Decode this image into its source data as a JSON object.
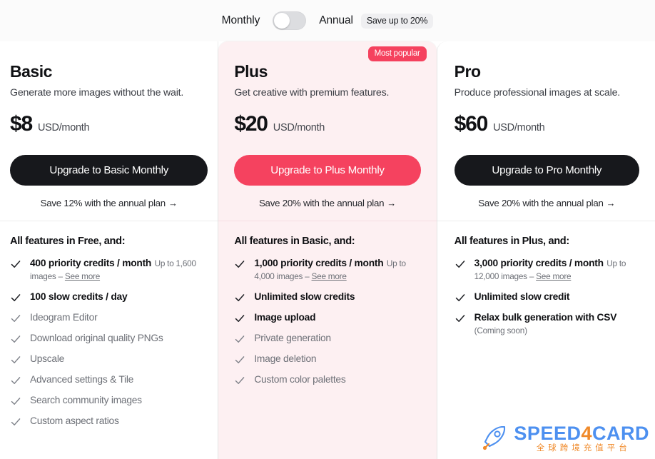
{
  "billing_toggle": {
    "monthly_label": "Monthly",
    "annual_label": "Annual",
    "save_badge": "Save up to 20%",
    "selected": "Monthly"
  },
  "colors": {
    "accent_red": "#f5425f",
    "plus_card_bg": "#fdf0f2",
    "dark_button": "#17181c",
    "muted_text": "#6d7077",
    "watermark_blue": "#4d90f0",
    "watermark_orange": "#f08a2a"
  },
  "plans": [
    {
      "id": "basic",
      "name": "Basic",
      "description": "Generate more images without the wait.",
      "price": "$8",
      "price_unit": "USD/month",
      "cta_label": "Upgrade to Basic Monthly",
      "annual_link": "Save 12% with the annual plan",
      "badge": null,
      "features_title": "All features in Free, and:",
      "features": [
        {
          "label": "400 priority credits / month",
          "sub": "Up to 1,600 images – ",
          "sub_link": "See more",
          "emphasis": true
        },
        {
          "label": "100 slow credits / day",
          "sub": null,
          "sub_link": null,
          "emphasis": true
        },
        {
          "label": "Ideogram Editor",
          "sub": null,
          "sub_link": null,
          "emphasis": false
        },
        {
          "label": "Download original quality PNGs",
          "sub": null,
          "sub_link": null,
          "emphasis": false
        },
        {
          "label": "Upscale",
          "sub": null,
          "sub_link": null,
          "emphasis": false
        },
        {
          "label": "Advanced settings & Tile",
          "sub": null,
          "sub_link": null,
          "emphasis": false
        },
        {
          "label": "Search community images",
          "sub": null,
          "sub_link": null,
          "emphasis": false
        },
        {
          "label": "Custom aspect ratios",
          "sub": null,
          "sub_link": null,
          "emphasis": false
        }
      ]
    },
    {
      "id": "plus",
      "name": "Plus",
      "description": "Get creative with premium features.",
      "price": "$20",
      "price_unit": "USD/month",
      "cta_label": "Upgrade to Plus Monthly",
      "annual_link": "Save 20% with the annual plan",
      "badge": "Most popular",
      "features_title": "All features in Basic, and:",
      "features": [
        {
          "label": "1,000 priority credits / month",
          "sub": "Up to 4,000 images – ",
          "sub_link": "See more",
          "emphasis": true
        },
        {
          "label": "Unlimited slow credits",
          "sub": null,
          "sub_link": null,
          "emphasis": true
        },
        {
          "label": "Image upload",
          "sub": null,
          "sub_link": null,
          "emphasis": true
        },
        {
          "label": "Private generation",
          "sub": null,
          "sub_link": null,
          "emphasis": false
        },
        {
          "label": "Image deletion",
          "sub": null,
          "sub_link": null,
          "emphasis": false
        },
        {
          "label": "Custom color palettes",
          "sub": null,
          "sub_link": null,
          "emphasis": false
        }
      ]
    },
    {
      "id": "pro",
      "name": "Pro",
      "description": "Produce professional images at scale.",
      "price": "$60",
      "price_unit": "USD/month",
      "cta_label": "Upgrade to Pro Monthly",
      "annual_link": "Save 20% with the annual plan",
      "badge": null,
      "features_title": "All features in Plus, and:",
      "features": [
        {
          "label": "3,000 priority credits / month",
          "sub": "Up to 12,000 images – ",
          "sub_link": "See more",
          "emphasis": true
        },
        {
          "label": "Unlimited slow credit",
          "sub": null,
          "sub_link": null,
          "emphasis": true
        },
        {
          "label": "Relax bulk generation with CSV",
          "sub": "(Coming soon)",
          "sub_link": null,
          "emphasis": true
        }
      ]
    }
  ],
  "watermark": {
    "main_prefix": "SPEED",
    "main_accent": "4",
    "main_suffix": "CARD",
    "subtitle": "全球跨境充值平台"
  },
  "link_arrow": "→"
}
